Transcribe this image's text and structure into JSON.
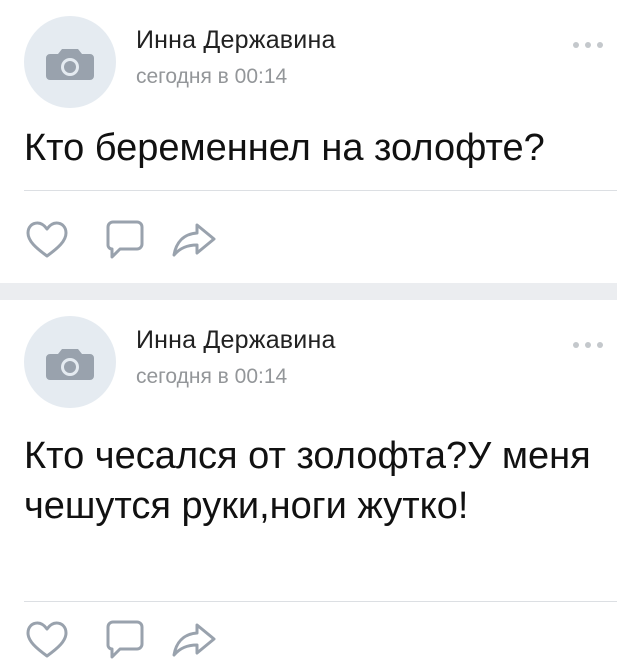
{
  "posts": [
    {
      "author": "Инна Державина",
      "time": "сегодня в 00:14",
      "text": "Кто беременнел на золофте?"
    },
    {
      "author": "Инна Державина",
      "time": "сегодня в 00:14",
      "text": "Кто чесался от золофта?У меня чешутся руки,ноги жутко!"
    }
  ],
  "icons": {
    "avatar": "camera-icon",
    "more": "more-icon",
    "like": "heart-icon",
    "comment": "comment-icon",
    "share": "share-icon"
  },
  "colors": {
    "author": "#222222",
    "time": "#939699",
    "icon": "#99a2ad",
    "separator": "#ebedf0"
  }
}
